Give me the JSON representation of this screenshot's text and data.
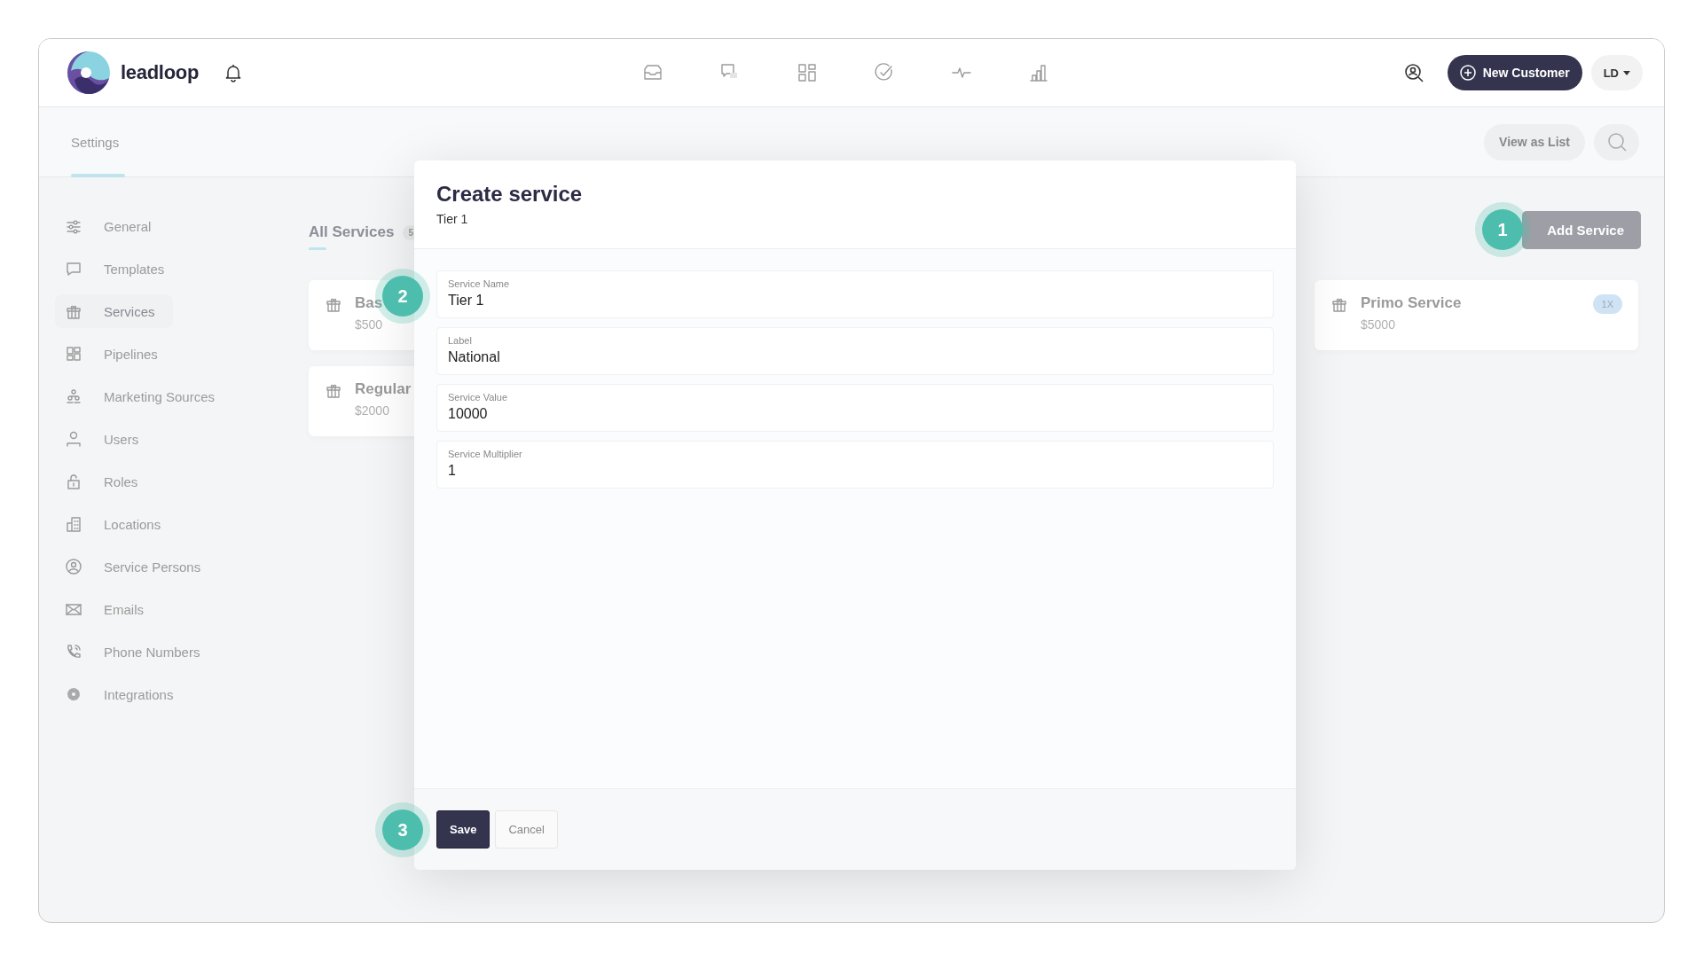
{
  "header": {
    "brand": "leadloop",
    "new_customer": "New Customer",
    "user_menu": "LD"
  },
  "settings_bar": {
    "title": "Settings",
    "view_as_list": "View as List"
  },
  "sidebar": {
    "items": [
      {
        "label": "General",
        "selected": false
      },
      {
        "label": "Templates",
        "selected": false
      },
      {
        "label": "Services",
        "selected": true
      },
      {
        "label": "Pipelines",
        "selected": false
      },
      {
        "label": "Marketing Sources",
        "selected": false
      },
      {
        "label": "Users",
        "selected": false
      },
      {
        "label": "Roles",
        "selected": false
      },
      {
        "label": "Locations",
        "selected": false
      },
      {
        "label": "Service Persons",
        "selected": false
      },
      {
        "label": "Emails",
        "selected": false
      },
      {
        "label": "Phone Numbers",
        "selected": false
      },
      {
        "label": "Integrations",
        "selected": false
      }
    ]
  },
  "tabs": [
    {
      "label": "All Services",
      "count": "5",
      "selected": true
    }
  ],
  "add_service": "Add Service",
  "cards": [
    {
      "title": "Bas",
      "price": "$500"
    },
    {
      "title": "Regular",
      "price": "$2000"
    },
    {
      "title": "Primo Service",
      "price": "$5000",
      "badge": "1X"
    }
  ],
  "modal": {
    "title": "Create service",
    "subtitle": "Tier 1",
    "fields": [
      {
        "label": "Service Name",
        "value": "Tier 1"
      },
      {
        "label": "Label",
        "value": "National"
      },
      {
        "label": "Service Value",
        "value": "10000"
      },
      {
        "label": "Service Multiplier",
        "value": "1"
      }
    ],
    "buttons": [
      {
        "label": "Save",
        "kind": "primary"
      },
      {
        "label": "Cancel",
        "kind": "secondary"
      }
    ]
  },
  "steps": [
    {
      "number": "1"
    },
    {
      "number": "2"
    },
    {
      "number": "3"
    }
  ]
}
